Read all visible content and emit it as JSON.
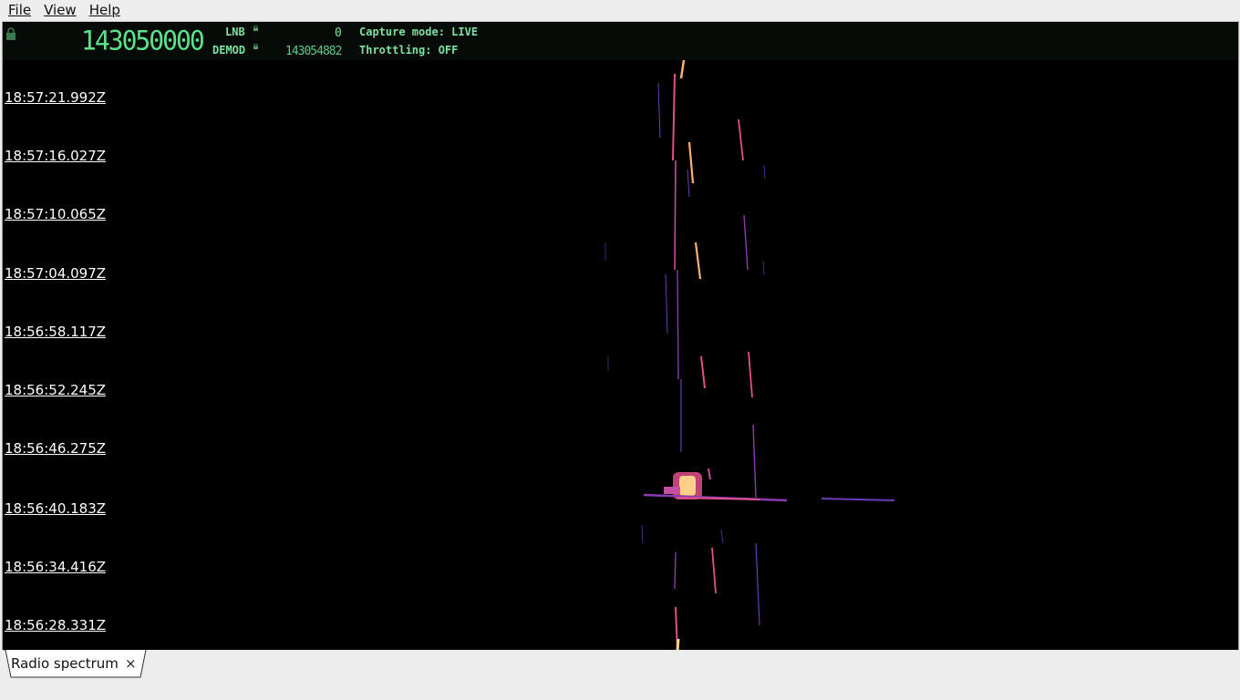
{
  "menu": {
    "items": [
      "File",
      "View",
      "Help"
    ]
  },
  "header": {
    "frequency": "143050000",
    "lnb_label": "LNB",
    "lnb_value": "0",
    "demod_label": "DEMOD",
    "demod_value": "143054882",
    "capture_mode": "Capture mode: LIVE",
    "throttling": "Throttling: OFF"
  },
  "waterfall": {
    "timestamps": [
      "18:57:21.992Z",
      "18:57:16.027Z",
      "18:57:10.065Z",
      "18:57:04.097Z",
      "18:56:58.117Z",
      "18:56:52.245Z",
      "18:56:46.275Z",
      "18:56:40.183Z",
      "18:56:34.416Z",
      "18:56:28.331Z"
    ]
  },
  "tabs": [
    {
      "label": "Radio spectrum",
      "close": "×"
    }
  ],
  "colors": {
    "background": "#000000",
    "accent": "#7ee0a0",
    "signal_hot": "#ffb070",
    "signal_mid": "#e0508a",
    "signal_low": "#6a3ab8"
  }
}
